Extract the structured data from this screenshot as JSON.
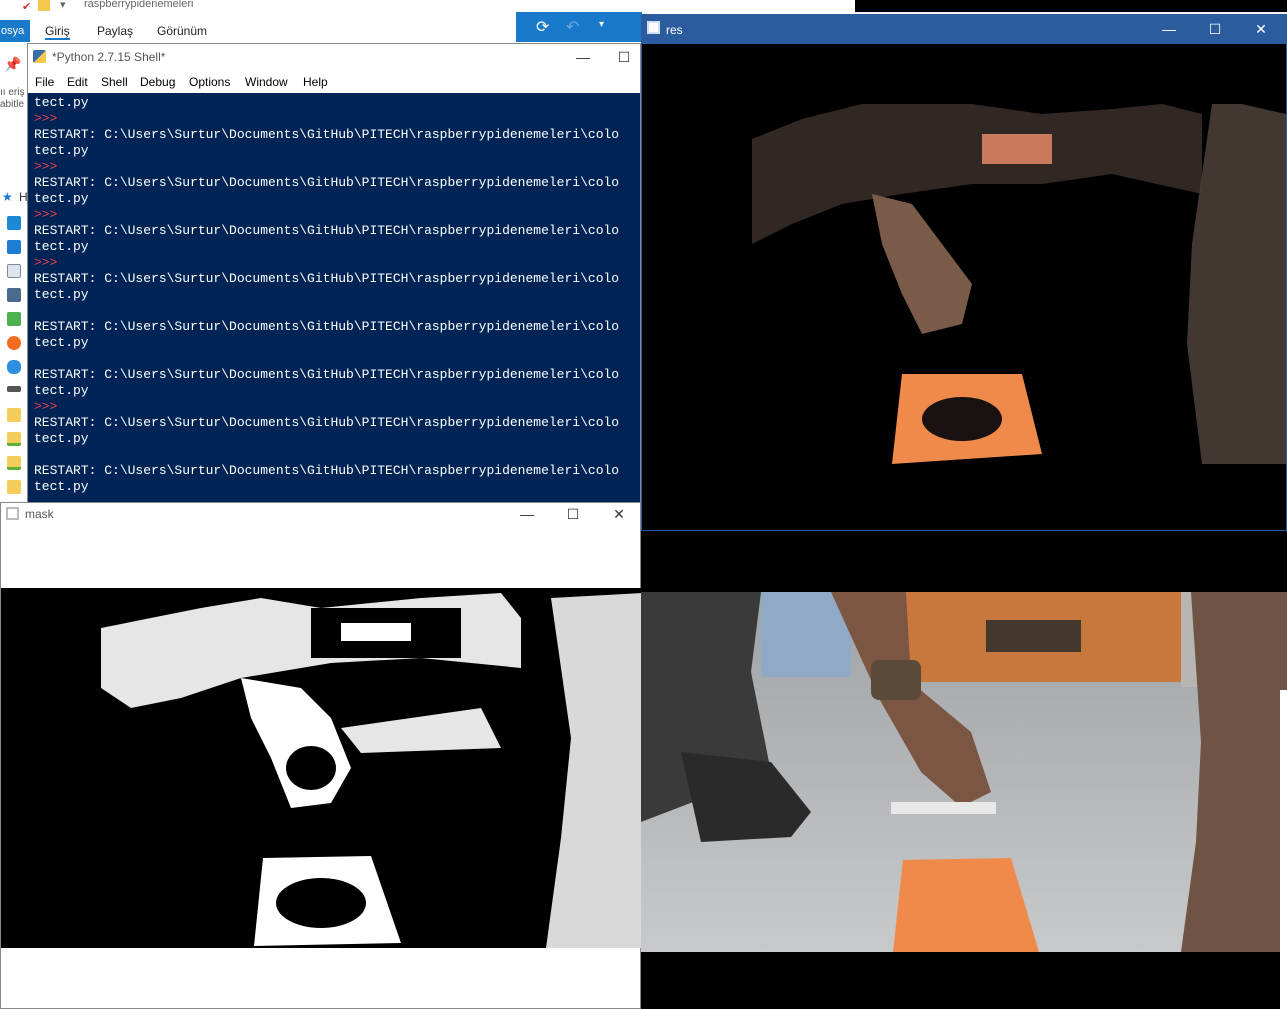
{
  "explorer": {
    "title": "raspberrypidenemeleri",
    "tabs": [
      "osya",
      "Giriş",
      "Paylaş",
      "Görünüm"
    ],
    "side_texts": [
      "ıı eriş",
      "abitle",
      "H"
    ]
  },
  "shell": {
    "title": "*Python 2.7.15 Shell*",
    "menu": [
      "File",
      "Edit",
      "Shell",
      "Debug",
      "Options",
      "Window",
      "Help"
    ],
    "lines": [
      {
        "type": "text",
        "text": "tect.py"
      },
      {
        "type": "prompt",
        "text": ">>>"
      },
      {
        "type": "text",
        "text": " RESTART: C:\\Users\\Surtur\\Documents\\GitHub\\PITECH\\raspberrypidenemeleri\\colo"
      },
      {
        "type": "text",
        "text": "tect.py"
      },
      {
        "type": "prompt",
        "text": ">>>"
      },
      {
        "type": "text",
        "text": " RESTART: C:\\Users\\Surtur\\Documents\\GitHub\\PITECH\\raspberrypidenemeleri\\colo"
      },
      {
        "type": "text",
        "text": "tect.py"
      },
      {
        "type": "prompt",
        "text": ">>>"
      },
      {
        "type": "text",
        "text": " RESTART: C:\\Users\\Surtur\\Documents\\GitHub\\PITECH\\raspberrypidenemeleri\\colo"
      },
      {
        "type": "text",
        "text": "tect.py"
      },
      {
        "type": "prompt",
        "text": ">>>"
      },
      {
        "type": "text",
        "text": " RESTART: C:\\Users\\Surtur\\Documents\\GitHub\\PITECH\\raspberrypidenemeleri\\colo"
      },
      {
        "type": "text",
        "text": "tect.py"
      },
      {
        "type": "prompt",
        "text": ""
      },
      {
        "type": "text",
        "text": " RESTART: C:\\Users\\Surtur\\Documents\\GitHub\\PITECH\\raspberrypidenemeleri\\colo"
      },
      {
        "type": "text",
        "text": "tect.py"
      },
      {
        "type": "prompt",
        "text": ""
      },
      {
        "type": "text",
        "text": " RESTART: C:\\Users\\Surtur\\Documents\\GitHub\\PITECH\\raspberrypidenemeleri\\colo"
      },
      {
        "type": "text",
        "text": "tect.py"
      },
      {
        "type": "prompt",
        "text": ">>>"
      },
      {
        "type": "text",
        "text": " RESTART: C:\\Users\\Surtur\\Documents\\GitHub\\PITECH\\raspberrypidenemeleri\\colo"
      },
      {
        "type": "text",
        "text": "tect.py"
      },
      {
        "type": "prompt",
        "text": ""
      },
      {
        "type": "text",
        "text": " RESTART: C:\\Users\\Surtur\\Documents\\GitHub\\PITECH\\raspberrypidenemeleri\\colo"
      },
      {
        "type": "text",
        "text": "tect.py"
      }
    ]
  },
  "res": {
    "title": "res"
  },
  "mask": {
    "title": "mask"
  },
  "controls": {
    "minimize": "—",
    "maximize": "☐",
    "close": "✕"
  },
  "colors": {
    "console_bg": "#012456",
    "prompt": "#e04050",
    "res_title": "#2b5d9e",
    "book": "#f08a4b"
  }
}
